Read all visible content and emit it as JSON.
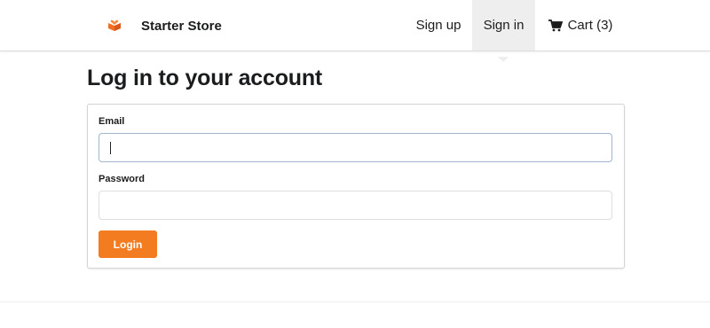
{
  "brand": {
    "name": "Starter Store",
    "logo_icon": "heart-box-icon",
    "logo_color": "#f16e22"
  },
  "nav": {
    "signup_label": "Sign up",
    "signin_label": "Sign in",
    "cart_label": "Cart (3)",
    "cart_icon": "shopping-cart-icon",
    "active_item": "signin",
    "active_bg": "#eeeeee"
  },
  "page": {
    "title": "Log in to your account"
  },
  "form": {
    "email_label": "Email",
    "email_value": "",
    "email_placeholder": "",
    "password_label": "Password",
    "password_value": "",
    "password_placeholder": "",
    "submit_label": "Login",
    "accent_color": "#f47c20"
  }
}
